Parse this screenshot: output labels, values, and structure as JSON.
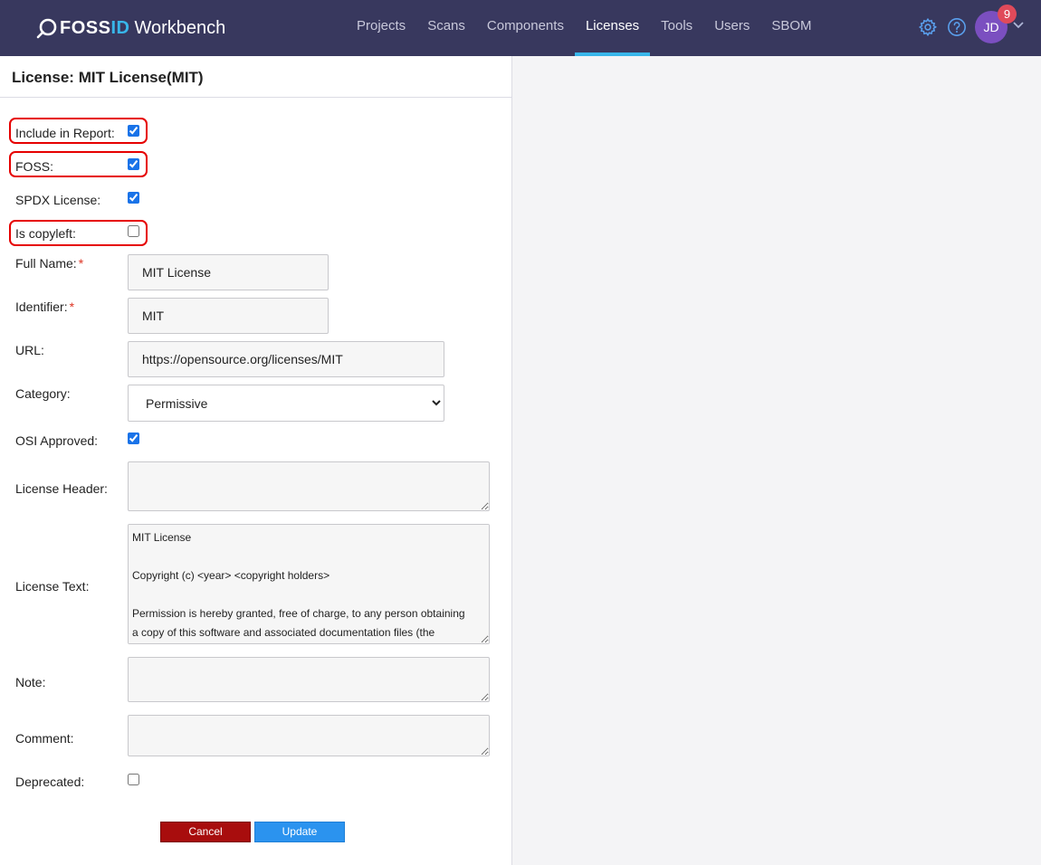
{
  "brand": {
    "foss": "FOSS",
    "id": "ID",
    "product": "Workbench"
  },
  "nav": {
    "items": [
      {
        "label": "Projects"
      },
      {
        "label": "Scans"
      },
      {
        "label": "Components"
      },
      {
        "label": "Licenses"
      },
      {
        "label": "Tools"
      },
      {
        "label": "Users"
      },
      {
        "label": "SBOM"
      }
    ],
    "active": "Licenses"
  },
  "user": {
    "initials": "JD",
    "notifications": "9"
  },
  "icons": {
    "settings": "gear-icon",
    "help": "question-circle-icon",
    "menu": "chevron-down-icon"
  },
  "colors": {
    "topbar": "#38385e",
    "accent": "#38b6ea",
    "avatar": "#7b4fc0",
    "badge": "#e04a5a",
    "highlight": "#e60000",
    "cancel": "#a80d0d",
    "update": "#2b93ef"
  },
  "panel": {
    "title": "License: MIT License(MIT)"
  },
  "form": {
    "include_in_report": {
      "label": "Include in Report:",
      "checked": true,
      "highlighted": true
    },
    "foss": {
      "label": "FOSS:",
      "checked": true,
      "highlighted": true
    },
    "spdx_license": {
      "label": "SPDX License:",
      "checked": true
    },
    "is_copyleft": {
      "label": "Is copyleft:",
      "checked": false,
      "highlighted": true
    },
    "full_name": {
      "label": "Full Name:",
      "required": "*",
      "value": "MIT License"
    },
    "identifier": {
      "label": "Identifier:",
      "required": "*",
      "value": "MIT"
    },
    "url": {
      "label": "URL:",
      "value": "https://opensource.org/licenses/MIT"
    },
    "category": {
      "label": "Category:",
      "value": "Permissive"
    },
    "osi_approved": {
      "label": "OSI Approved:",
      "checked": true
    },
    "license_header": {
      "label": "License Header:",
      "value": ""
    },
    "license_text": {
      "label": "License Text:",
      "value": "MIT License\n\nCopyright (c) <year> <copyright holders>\n\nPermission is hereby granted, free of charge, to any person obtaining a copy of this software and associated documentation files (the"
    },
    "note": {
      "label": "Note:",
      "value": ""
    },
    "comment": {
      "label": "Comment:",
      "value": ""
    },
    "deprecated": {
      "label": "Deprecated:",
      "checked": false
    }
  },
  "buttons": {
    "cancel": "Cancel",
    "update": "Update"
  }
}
